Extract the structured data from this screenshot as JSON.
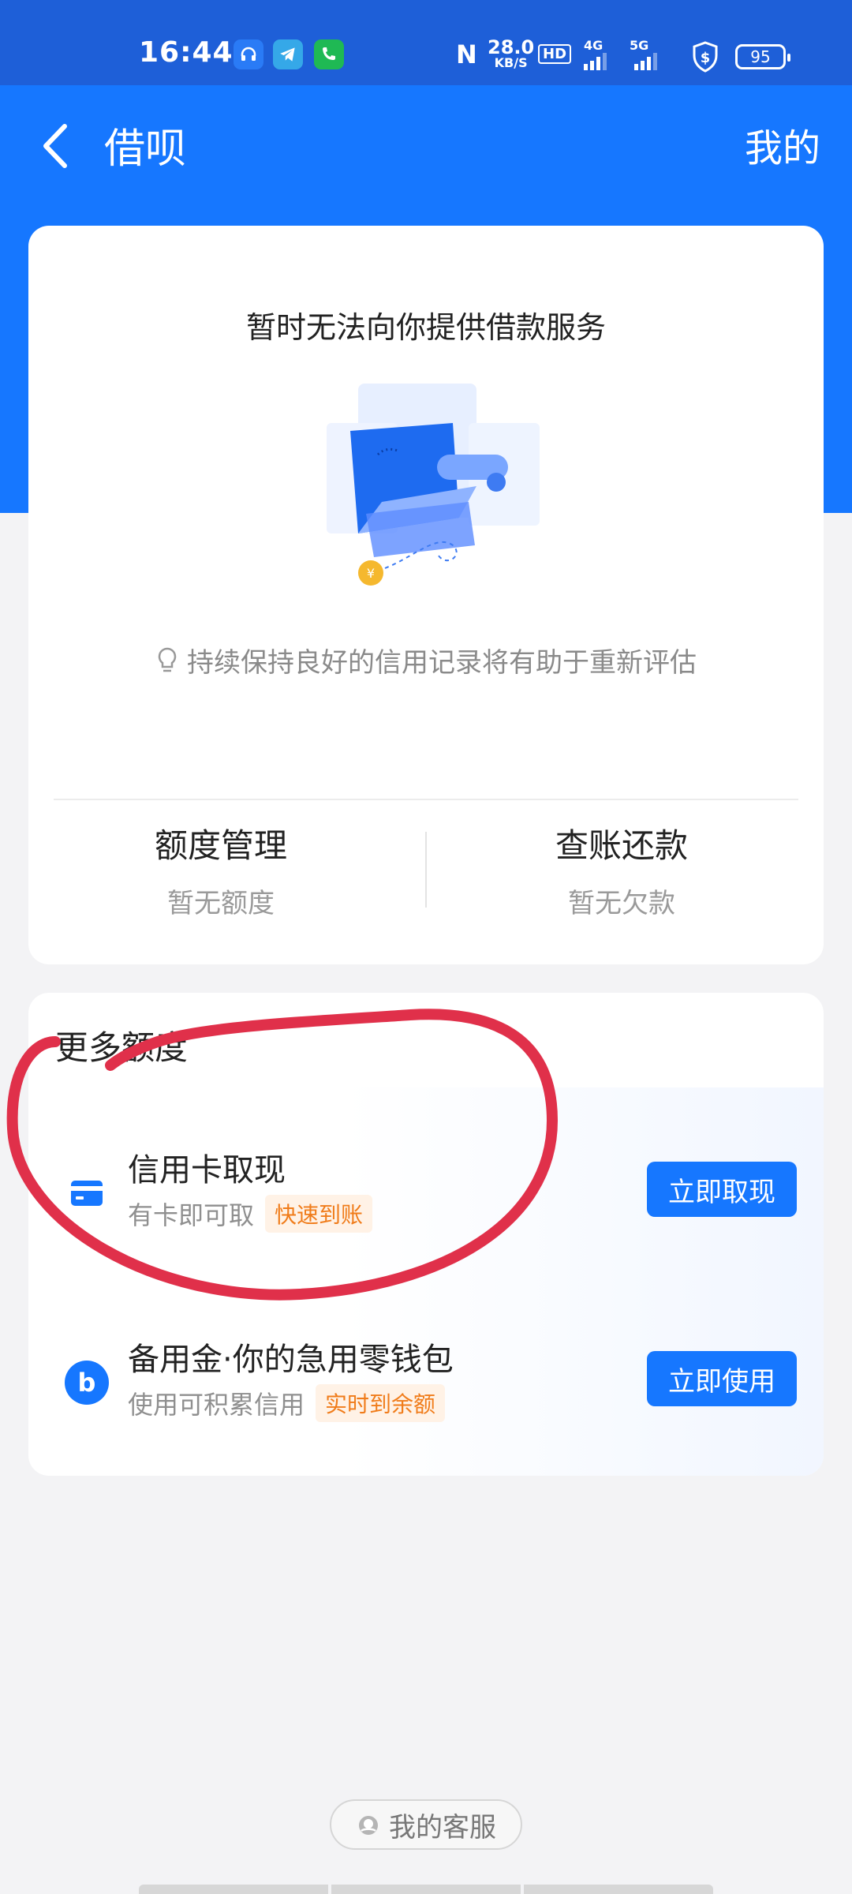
{
  "status_bar": {
    "time": "16:44",
    "net_speed_value": "28.0",
    "net_speed_unit": "KB/S",
    "hd_label": "HD",
    "net_4g": "4G",
    "net_5g": "5G",
    "battery": "95"
  },
  "nav": {
    "title": "借呗",
    "right_label": "我的"
  },
  "notice": {
    "title": "暂时无法向你提供借款服务",
    "hint": "持续保持良好的信用记录将有助于重新评估"
  },
  "stats": [
    {
      "title": "额度管理",
      "sub": "暂无额度"
    },
    {
      "title": "查账还款",
      "sub": "暂无欠款"
    }
  ],
  "more": {
    "title": "更多额度",
    "items": [
      {
        "title": "信用卡取现",
        "sub": "有卡即可取",
        "tag": "快速到账",
        "button": "立即取现",
        "icon": "credit-card-icon"
      },
      {
        "title": "备用金·你的急用零钱包",
        "sub": "使用可积累信用",
        "tag": "实时到余额",
        "button": "立即使用",
        "icon": "beiyongjin-b-icon"
      }
    ]
  },
  "service": {
    "label": "我的客服"
  },
  "colors": {
    "brand_blue": "#1677ff",
    "status_blue": "#1e5fd8",
    "tag_orange": "#f07c1a",
    "annotation_red": "#e0304a"
  }
}
